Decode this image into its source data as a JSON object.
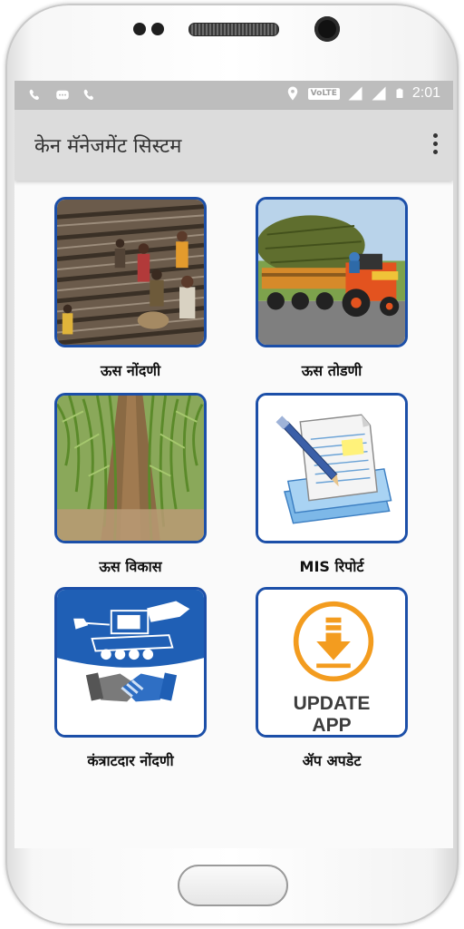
{
  "status_bar": {
    "time": "2:01",
    "network_label": "VoLTE",
    "icons": [
      "call-icon",
      "message-icon",
      "call-icon",
      "location-icon",
      "signal-icon",
      "battery-icon"
    ]
  },
  "app_bar": {
    "title": "केन मॅनेजमेंट सिस्टम",
    "menu_icon": "more-vert-icon"
  },
  "tiles": [
    {
      "label": "ऊस नोंदणी",
      "icon": "sugarcane-planting-photo"
    },
    {
      "label": "ऊस तोडणी",
      "icon": "sugarcane-tractor-photo"
    },
    {
      "label": "ऊस विकास",
      "icon": "sugarcane-field-photo"
    },
    {
      "label": "MIS रिपोर्ट",
      "icon": "report-documents-icon"
    },
    {
      "label": "कंत्राटदार नोंदणी",
      "icon": "harvester-handshake-icon"
    },
    {
      "label": "ॲप अपडेट",
      "icon": "download-icon",
      "image_text": [
        "UPDATE",
        "APP"
      ]
    }
  ],
  "colors": {
    "card_border": "#1c4fa8",
    "update_orange": "#f39c1f",
    "app_bar": "#dcdcdc",
    "status_bar": "#bdbdbd"
  }
}
